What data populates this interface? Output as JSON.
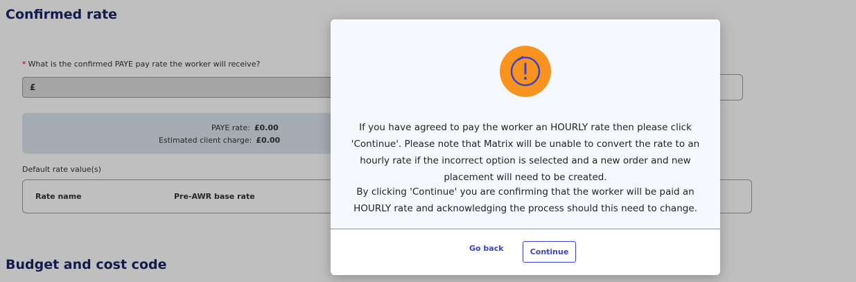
{
  "sections": {
    "confirmed_rate_title": "Confirmed rate",
    "budget_title": "Budget and cost code"
  },
  "form": {
    "required_marker": "*",
    "pay_rate_label": "What is the confirmed PAYE pay rate the worker will receive?",
    "currency_prefix": "£"
  },
  "summary": {
    "paye_rate_label": "PAYE rate:",
    "paye_rate_value": "£0.00",
    "client_charge_label": "Estimated client charge:",
    "client_charge_value": "£0.00"
  },
  "rates_table": {
    "label": "Default rate value(s)",
    "columns": [
      "Rate name",
      "Pre-AWR base rate"
    ]
  },
  "modal": {
    "icon": "alert-exclamation-icon",
    "message_1": "If you have agreed to pay the worker an HOURLY rate then please click 'Continue'. Please note that Matrix will be unable to convert the rate to an hourly rate if the incorrect option is selected and a new order and new placement will need to be created.",
    "message_2": "By clicking 'Continue' you are confirming that the worker will be paid an HOURLY rate and acknowledging the process should this need to change.",
    "back_label": "Go back",
    "continue_label": "Continue"
  },
  "colors": {
    "accent": "#3c42c8",
    "warning": "#f7931e",
    "heading": "#1b2466"
  }
}
